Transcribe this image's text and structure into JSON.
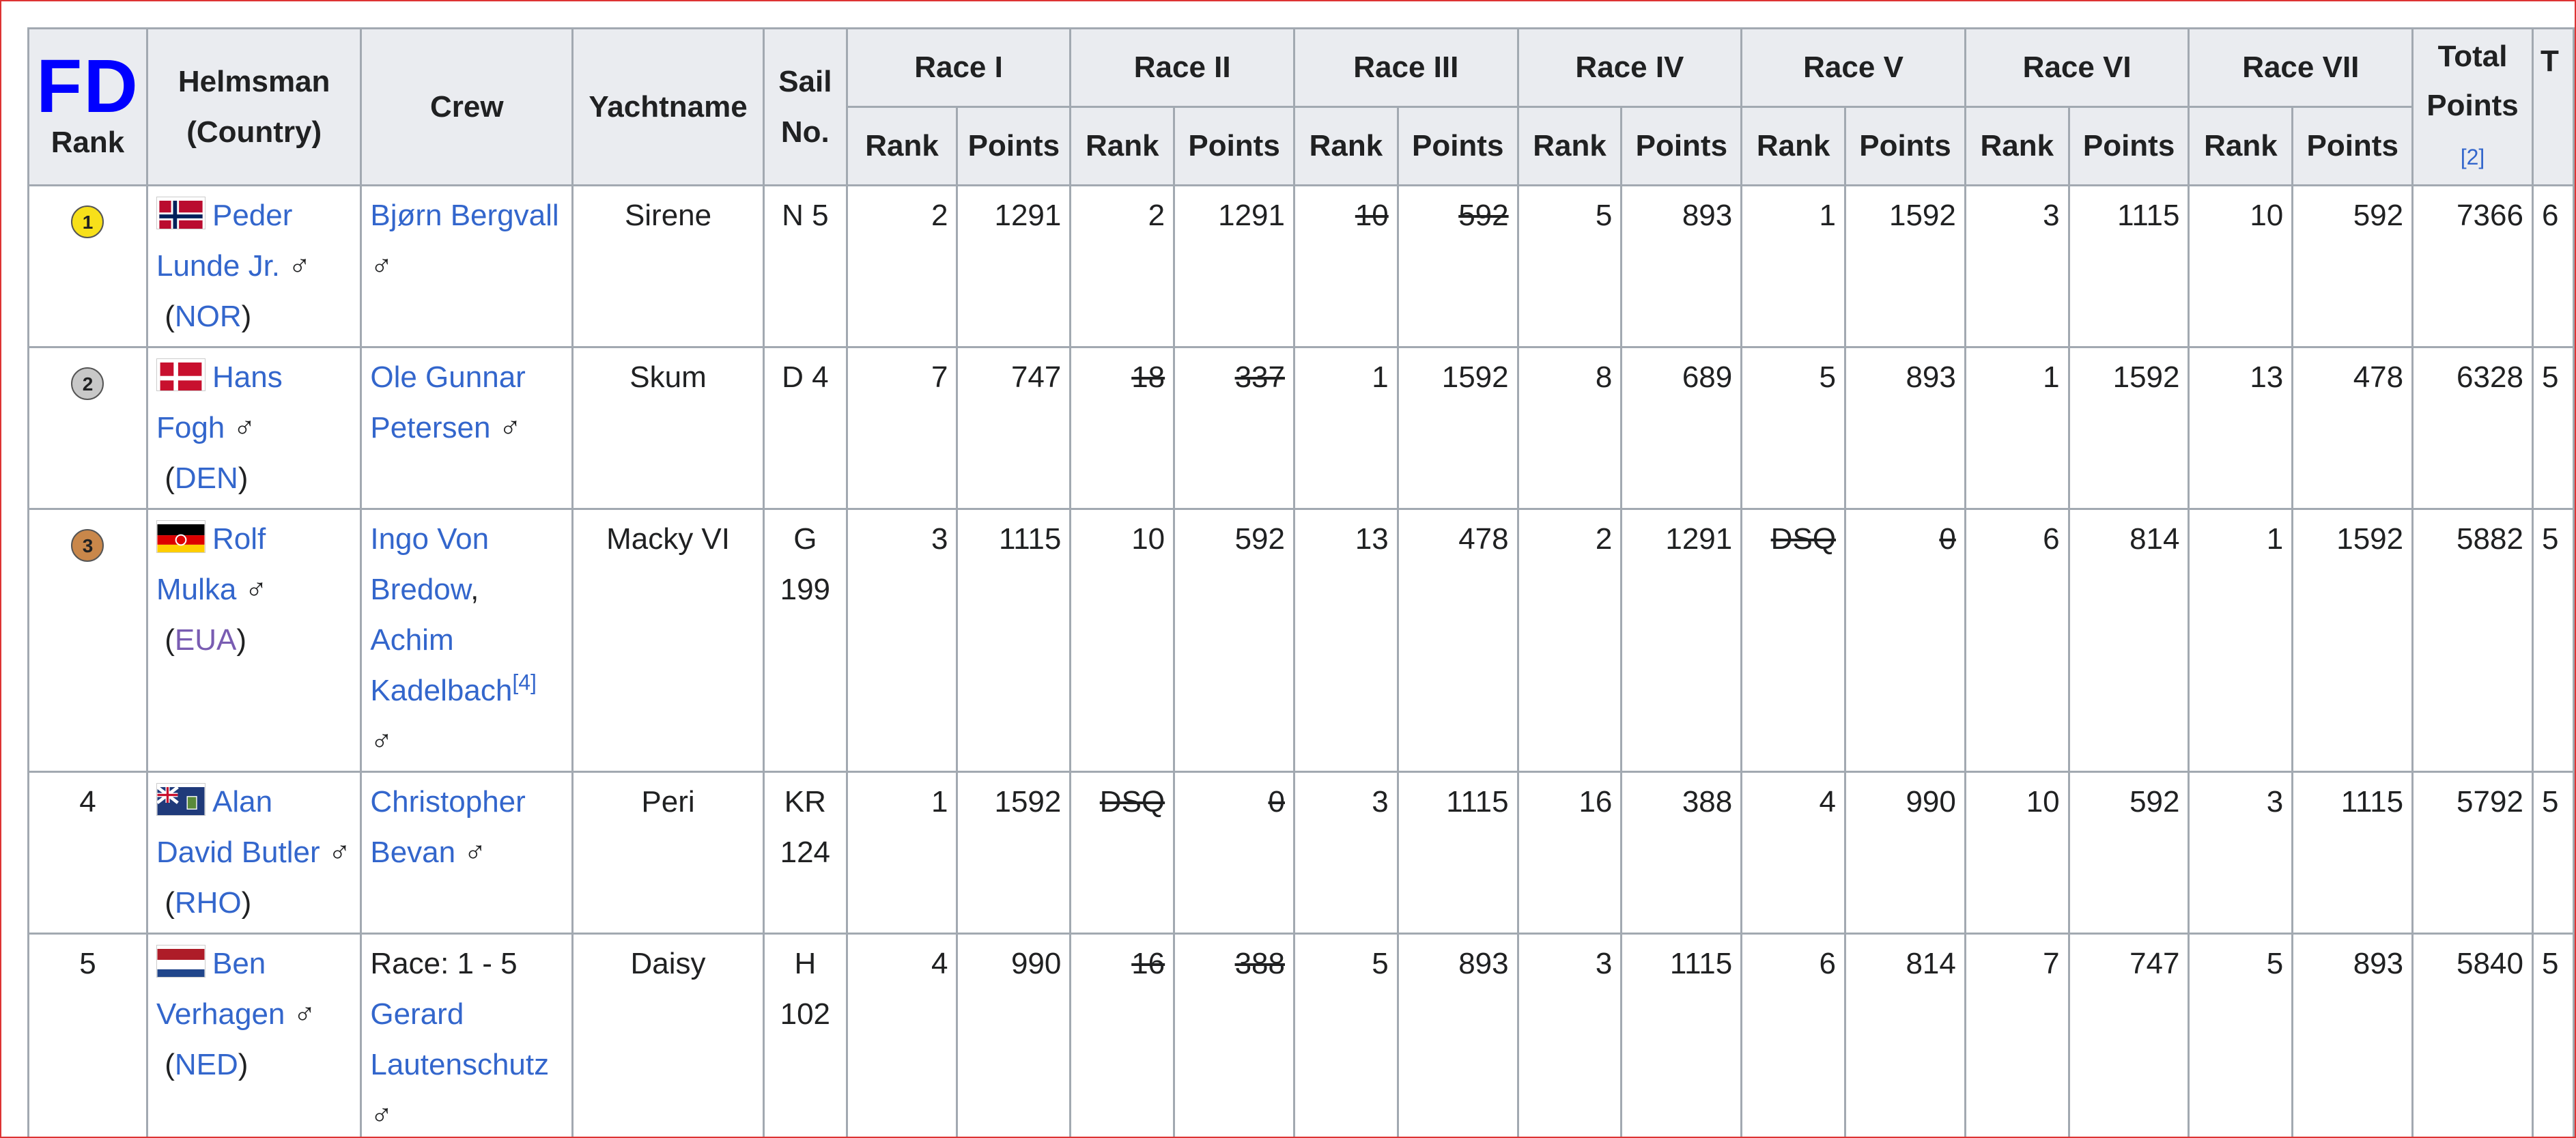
{
  "header": {
    "logo": "FD",
    "rank": "Rank",
    "helmsman": "Helmsman (Country)",
    "crew": "Crew",
    "yachtname": "Yachtname",
    "sail_no": "Sail No.",
    "race_labels": [
      "Race I",
      "Race II",
      "Race III",
      "Race IV",
      "Race V",
      "Race VI",
      "Race VII"
    ],
    "sub_rank": "Rank",
    "sub_points": "Points",
    "total_line1": "Total",
    "total_line2": "Points",
    "total_ref": "[2]",
    "cut_header": "T"
  },
  "colors": {
    "gold": "#f7e01a",
    "silver": "#c8c8c8",
    "bronze": "#c9874a",
    "link": "#3366cc",
    "visited_link": "#795cb2",
    "logo_blue": "#0000ff"
  },
  "rows": [
    {
      "rank": "1",
      "medal": "gold",
      "flag": "NOR",
      "helm_name": "Peder Lunde Jr.",
      "helm_sym": "♂",
      "country": "NOR",
      "crew_name": "Bjørn Bergvall",
      "crew_sym": "♂",
      "yacht": "Sirene",
      "sail": "N 5",
      "races": [
        {
          "rank": "2",
          "points": "1291",
          "dropped": false
        },
        {
          "rank": "2",
          "points": "1291",
          "dropped": false
        },
        {
          "rank": "10",
          "points": "592",
          "dropped": true
        },
        {
          "rank": "5",
          "points": "893",
          "dropped": false
        },
        {
          "rank": "1",
          "points": "1592",
          "dropped": false
        },
        {
          "rank": "3",
          "points": "1115",
          "dropped": false
        },
        {
          "rank": "10",
          "points": "592",
          "dropped": false
        }
      ],
      "total": "7366",
      "cut": "6"
    },
    {
      "rank": "2",
      "medal": "silver",
      "flag": "DEN",
      "helm_name": "Hans Fogh",
      "helm_sym": "♂",
      "country": "DEN",
      "crew_name": "Ole Gunnar Petersen",
      "crew_sym": "♂",
      "yacht": "Skum",
      "sail": "D 4",
      "races": [
        {
          "rank": "7",
          "points": "747",
          "dropped": false
        },
        {
          "rank": "18",
          "points": "337",
          "dropped": true
        },
        {
          "rank": "1",
          "points": "1592",
          "dropped": false
        },
        {
          "rank": "8",
          "points": "689",
          "dropped": false
        },
        {
          "rank": "5",
          "points": "893",
          "dropped": false
        },
        {
          "rank": "1",
          "points": "1592",
          "dropped": false
        },
        {
          "rank": "13",
          "points": "478",
          "dropped": false
        }
      ],
      "total": "6328",
      "cut": "5"
    },
    {
      "rank": "3",
      "medal": "bronze",
      "flag": "EUA",
      "helm_name": "Rolf Mulka",
      "helm_sym": "♂",
      "country": "EUA",
      "crew_name": "Ingo Von Bredow",
      "crew_sep": ",",
      "crew_name2": "Achim Kadelbach",
      "crew_ref": "[4]",
      "crew_sym": "♂",
      "yacht": "Macky VI",
      "sail": "G 199",
      "races": [
        {
          "rank": "3",
          "points": "1115",
          "dropped": false
        },
        {
          "rank": "10",
          "points": "592",
          "dropped": false
        },
        {
          "rank": "13",
          "points": "478",
          "dropped": false
        },
        {
          "rank": "2",
          "points": "1291",
          "dropped": false
        },
        {
          "rank": "DSQ",
          "points": "0",
          "dropped": true
        },
        {
          "rank": "6",
          "points": "814",
          "dropped": false
        },
        {
          "rank": "1",
          "points": "1592",
          "dropped": false
        }
      ],
      "total": "5882",
      "cut": "5"
    },
    {
      "rank": "4",
      "medal": "",
      "flag": "RHO",
      "helm_name": "Alan David Butler",
      "helm_sym": "♂",
      "country": "RHO",
      "crew_name": "Christopher Bevan",
      "crew_sym": "♂",
      "yacht": "Peri",
      "sail": "KR 124",
      "races": [
        {
          "rank": "1",
          "points": "1592",
          "dropped": false
        },
        {
          "rank": "DSQ",
          "points": "0",
          "dropped": true
        },
        {
          "rank": "3",
          "points": "1115",
          "dropped": false
        },
        {
          "rank": "16",
          "points": "388",
          "dropped": false
        },
        {
          "rank": "4",
          "points": "990",
          "dropped": false
        },
        {
          "rank": "10",
          "points": "592",
          "dropped": false
        },
        {
          "rank": "3",
          "points": "1115",
          "dropped": false
        }
      ],
      "total": "5792",
      "cut": "5"
    },
    {
      "rank": "5",
      "medal": "",
      "flag": "NED",
      "helm_name": "Ben Verhagen",
      "helm_sym": "♂",
      "country": "NED",
      "crew_prefix": "Race: 1 - 5",
      "crew_name": "Gerard Lautenschutz",
      "crew_sym": "♂",
      "yacht": "Daisy",
      "sail": "H 102",
      "races": [
        {
          "rank": "4",
          "points": "990",
          "dropped": false
        },
        {
          "rank": "16",
          "points": "388",
          "dropped": true
        },
        {
          "rank": "5",
          "points": "893",
          "dropped": false
        },
        {
          "rank": "3",
          "points": "1115",
          "dropped": false
        },
        {
          "rank": "6",
          "points": "814",
          "dropped": false
        },
        {
          "rank": "7",
          "points": "747",
          "dropped": false
        },
        {
          "rank": "5",
          "points": "893",
          "dropped": false
        }
      ],
      "total": "5840",
      "cut": "5"
    }
  ]
}
